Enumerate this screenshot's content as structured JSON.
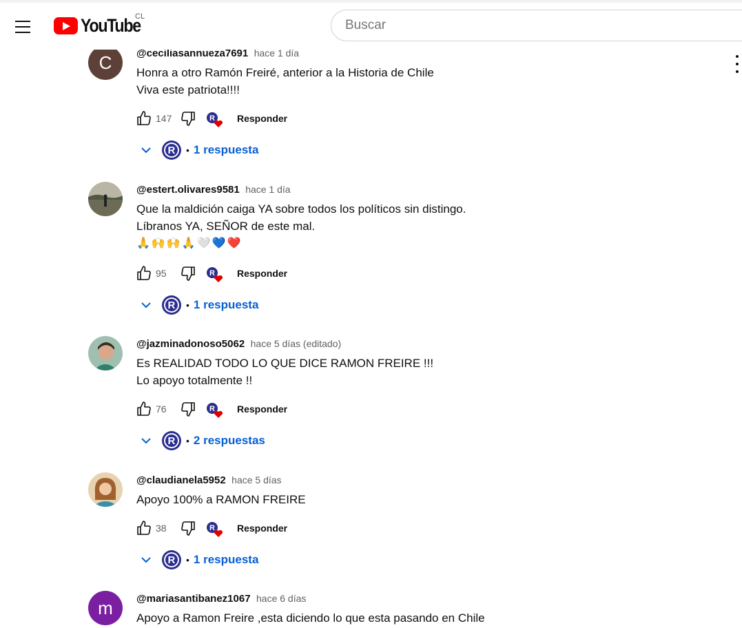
{
  "header": {
    "logo_text": "YouTube",
    "country": "CL",
    "search_placeholder": "Buscar"
  },
  "colors": {
    "brand_red": "#ff0000",
    "link_blue": "#065fd4",
    "muted": "#606060"
  },
  "reply_label": "Responder",
  "comments": [
    {
      "handle": "@ceciliasannueza7691",
      "time": "hace 1 día",
      "lines": [
        "Honra a  otro Ramón Freiré, anterior  a la Historia  de Chile",
        "Viva este patriota!!!!"
      ],
      "likes": "147",
      "replies": "1 respuesta",
      "avatar_letter": "C",
      "avatar_color": "#5d4037"
    },
    {
      "handle": "@estert.olivares9581",
      "time": "hace 1 día",
      "lines": [
        "Que la maldición caiga YA sobre todos los políticos sin distingo.",
        "Líbranos YA, SEÑOR de este mal."
      ],
      "emoji": "🙏🙌🙌🙏🤍💙❤️",
      "likes": "95",
      "replies": "1 respuesta",
      "avatar_color": "#8d8b7a"
    },
    {
      "handle": "@jazminadonoso5062",
      "time": "hace 5 días (editado)",
      "lines": [
        "Es REALIDAD TODO LO QUE DICE RAMON FREIRE !!!",
        "Lo apoyo totalmente !!"
      ],
      "likes": "76",
      "replies": "2 respuestas",
      "avatar_color": "#4a8a74"
    },
    {
      "handle": "@claudianela5952",
      "time": "hace 5 días",
      "lines": [
        "Apoyo 100% a RAMON FREIRE"
      ],
      "likes": "38",
      "replies": "1 respuesta",
      "avatar_color": "#b07a4a"
    },
    {
      "handle": "@mariasantibanez1067",
      "time": "hace 6 días",
      "lines": [
        "Apoyo a Ramon Freire ,esta diciendo lo que esta pasando en Chile"
      ],
      "avatar_letter": "m",
      "avatar_color": "#7b1fa2"
    }
  ]
}
